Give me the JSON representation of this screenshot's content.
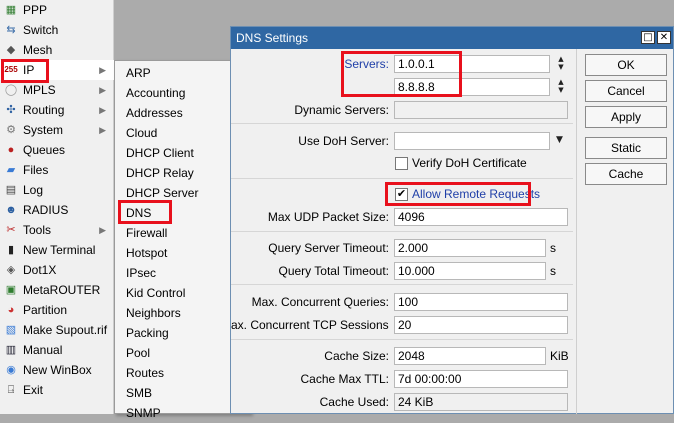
{
  "left_menu": {
    "items": [
      {
        "label": "PPP"
      },
      {
        "label": "Switch"
      },
      {
        "label": "Mesh"
      },
      {
        "label": "IP"
      },
      {
        "label": "MPLS"
      },
      {
        "label": "Routing"
      },
      {
        "label": "System"
      },
      {
        "label": "Queues"
      },
      {
        "label": "Files"
      },
      {
        "label": "Log"
      },
      {
        "label": "RADIUS"
      },
      {
        "label": "Tools"
      },
      {
        "label": "New Terminal"
      },
      {
        "label": "Dot1X"
      },
      {
        "label": "MetaROUTER"
      },
      {
        "label": "Partition"
      },
      {
        "label": "Make Supout.rif"
      },
      {
        "label": "Manual"
      },
      {
        "label": "New WinBox"
      },
      {
        "label": "Exit"
      }
    ]
  },
  "ip_submenu": {
    "items": [
      {
        "label": "ARP"
      },
      {
        "label": "Accounting"
      },
      {
        "label": "Addresses"
      },
      {
        "label": "Cloud"
      },
      {
        "label": "DHCP Client"
      },
      {
        "label": "DHCP Relay"
      },
      {
        "label": "DHCP Server"
      },
      {
        "label": "DNS"
      },
      {
        "label": "Firewall"
      },
      {
        "label": "Hotspot"
      },
      {
        "label": "IPsec"
      },
      {
        "label": "Kid Control"
      },
      {
        "label": "Neighbors"
      },
      {
        "label": "Packing"
      },
      {
        "label": "Pool"
      },
      {
        "label": "Routes"
      },
      {
        "label": "SMB"
      },
      {
        "label": "SNMP"
      }
    ]
  },
  "dialog": {
    "title": "DNS Settings",
    "servers_label": "Servers:",
    "servers": [
      "1.0.0.1",
      "8.8.8.8"
    ],
    "dynamic_servers_label": "Dynamic Servers:",
    "dynamic_servers_value": "",
    "doh_server_label": "Use DoH Server:",
    "doh_server_value": "",
    "verify_doh_label": "Verify DoH Certificate",
    "verify_doh_checked": false,
    "allow_remote_label": "Allow Remote Requests",
    "allow_remote_checked": true,
    "max_udp_label": "Max UDP Packet Size:",
    "max_udp_value": "4096",
    "query_server_timeout_label": "Query Server Timeout:",
    "query_server_timeout_value": "2.000",
    "query_total_timeout_label": "Query Total Timeout:",
    "query_total_timeout_value": "10.000",
    "timeout_unit": "s",
    "max_concurrent_queries_label": "Max. Concurrent Queries:",
    "max_concurrent_queries_value": "100",
    "max_concurrent_tcp_label": "ax. Concurrent TCP Sessions:",
    "max_concurrent_tcp_value": "20",
    "cache_size_label": "Cache Size:",
    "cache_size_value": "2048",
    "cache_size_unit": "KiB",
    "cache_max_ttl_label": "Cache Max TTL:",
    "cache_max_ttl_value": "7d 00:00:00",
    "cache_used_label": "Cache Used:",
    "cache_used_value": "24 KiB",
    "buttons": {
      "ok": "OK",
      "cancel": "Cancel",
      "apply": "Apply",
      "static": "Static",
      "cache": "Cache"
    }
  },
  "colors": {
    "highlight_red": "#e8101c",
    "titlebar": "#2f67a3",
    "link_blue": "#1f3fa8"
  }
}
